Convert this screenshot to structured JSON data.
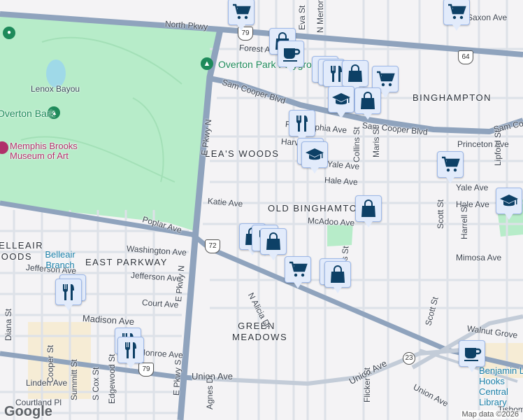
{
  "map": {
    "colors": {
      "land": "#f4f3f5",
      "park": "#b7ecc9",
      "highway": "#8fa3bd",
      "street": "#dde1e8",
      "marker_bg": "#e2ebfb",
      "marker_icon": "#0d4066"
    },
    "neighborhoods": [
      "LEA'S WOODS",
      "OLD BINGHAMTON",
      "BINGHAMPTON",
      "EAST PARKWAY",
      "GREEN MEADOWS",
      "BELLEAIR WOODS"
    ],
    "streets": [
      "North Pkwy",
      "Forest Ave",
      "Eva St",
      "N Merton St",
      "Sam Cooper Blvd",
      "Sam Cooper Blvd",
      "Sam Cooper Blvd",
      "E Pkwy N",
      "E Pkwy N",
      "E Pkwy S",
      "Princeton Ave",
      "Yale Ave",
      "Yale Ave",
      "Hale Ave",
      "Hale Ave",
      "Katie Ave",
      "McAdoo Ave",
      "Collins St",
      "Collins St",
      "Maris St",
      "Scott St",
      "Scott St",
      "Lipford St",
      "Harrell St",
      "Mimosa Ave",
      "Poplar Ave",
      "Washington Ave",
      "Jefferson Ave",
      "Jefferson Ave",
      "Court Ave",
      "Madison Ave",
      "N Alicia Dr",
      "Walnut Grove",
      "Union Ave",
      "Union Ave",
      "Union Ave",
      "Linden Ave",
      "Courtland Pl",
      "Diana St",
      "Cooper St",
      "Summitt St",
      "S Cox St",
      "Edgewood St",
      "Agnes Dr",
      "Flicker St",
      "Monroe Ave",
      "Harvard Ave",
      "Philadelphia Ave",
      "Saxon Ave",
      "Tishomingo"
    ],
    "pois": {
      "park_playground": "Overton Park Playground",
      "lenox": "Lenox Bayou",
      "overton_bark": "Overton Bark",
      "museum": "Memphis Brooks Museum of Art",
      "library_branch": "Belleair Branch",
      "central_library": "Benjamin L. Hooks Central Library"
    },
    "shields": [
      "79",
      "64",
      "72",
      "79",
      "23"
    ],
    "markers": [
      "cart",
      "bag",
      "coffee",
      "restaurant",
      "restaurant",
      "restaurant",
      "bag",
      "cart",
      "school",
      "bag",
      "restaurant",
      "school",
      "school",
      "cart",
      "cart",
      "school",
      "bag",
      "bag",
      "restaurant",
      "bag",
      "cart",
      "bag",
      "bag",
      "restaurant",
      "restaurant",
      "restaurant",
      "restaurant",
      "coffee"
    ],
    "attribution": "Map data ©2026",
    "logo": "Google"
  }
}
